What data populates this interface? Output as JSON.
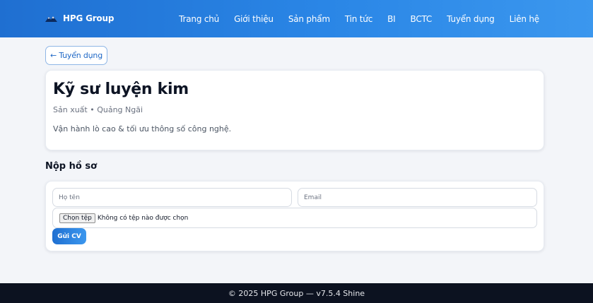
{
  "brand": {
    "name": "HPG Group",
    "logo_icon": "mountain-logo-icon"
  },
  "nav": {
    "items": [
      {
        "label": "Trang chủ"
      },
      {
        "label": "Giới thiệu"
      },
      {
        "label": "Sản phẩm"
      },
      {
        "label": "Tin tức"
      },
      {
        "label": "BI"
      },
      {
        "label": "BCTC"
      },
      {
        "label": "Tuyển dụng"
      },
      {
        "label": "Liên hệ"
      }
    ]
  },
  "back_button": {
    "label": "← Tuyển dụng"
  },
  "job": {
    "title": "Kỹ sư luyện kim",
    "meta": "Sản xuất • Quảng Ngãi",
    "description": "Vận hành lò cao & tối ưu thông số công nghệ."
  },
  "application": {
    "section_title": "Nộp hồ sơ",
    "name_placeholder": "Họ tên",
    "email_placeholder": "Email",
    "file_button_label": "Chọn tệp",
    "file_status": "Không có tệp nào được chọn",
    "submit_label": "Gửi CV"
  },
  "footer": {
    "text": "© 2025 HPG Group — v7.5.4 Shine"
  },
  "colors": {
    "header_start": "#1f6fd1",
    "header_end": "#3b97ee",
    "accent_text": "#1e67c6",
    "footer_bg": "#0c1220",
    "page_bg": "#f3f5f9"
  }
}
